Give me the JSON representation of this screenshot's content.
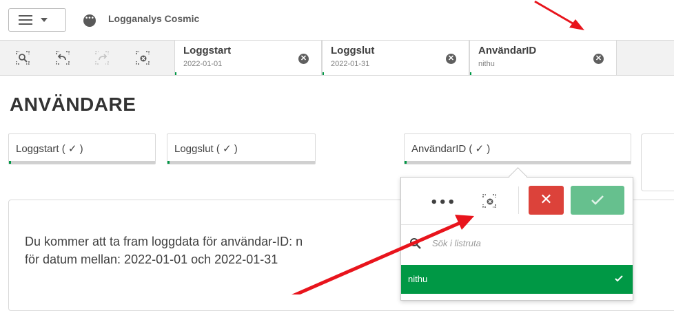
{
  "header": {
    "app_title": "Logganalys Cosmic"
  },
  "toolbar": {
    "tools": [
      "smart-search-icon",
      "step-back-icon",
      "step-forward-icon",
      "clear-selections-icon"
    ]
  },
  "selections": [
    {
      "title": "Loggstart",
      "value": "2022-01-01"
    },
    {
      "title": "Loggslut",
      "value": "2022-01-31"
    },
    {
      "title": "AnvändarID",
      "value": "nithu"
    }
  ],
  "page": {
    "title": "ANVÄNDARE"
  },
  "filters": [
    {
      "label": "Loggstart ( ✓ )"
    },
    {
      "label": "Loggslut ( ✓ )"
    },
    {
      "label": "AnvändarID ( ✓ )"
    }
  ],
  "message": {
    "line1": "Du kommer att ta fram loggdata för användar-ID: n",
    "line2": "för datum mellan: 2022-01-01 och 2022-01-31"
  },
  "listbox": {
    "more_label": "•••",
    "cancel_label": "✕",
    "search_placeholder": "Sök i listruta",
    "items": [
      {
        "label": "nithu",
        "selected": true
      }
    ]
  },
  "colors": {
    "accent_green": "#009845",
    "cancel_red": "#dc423a",
    "confirm_green": "#66c08e",
    "annotation_red": "#e8141c"
  }
}
